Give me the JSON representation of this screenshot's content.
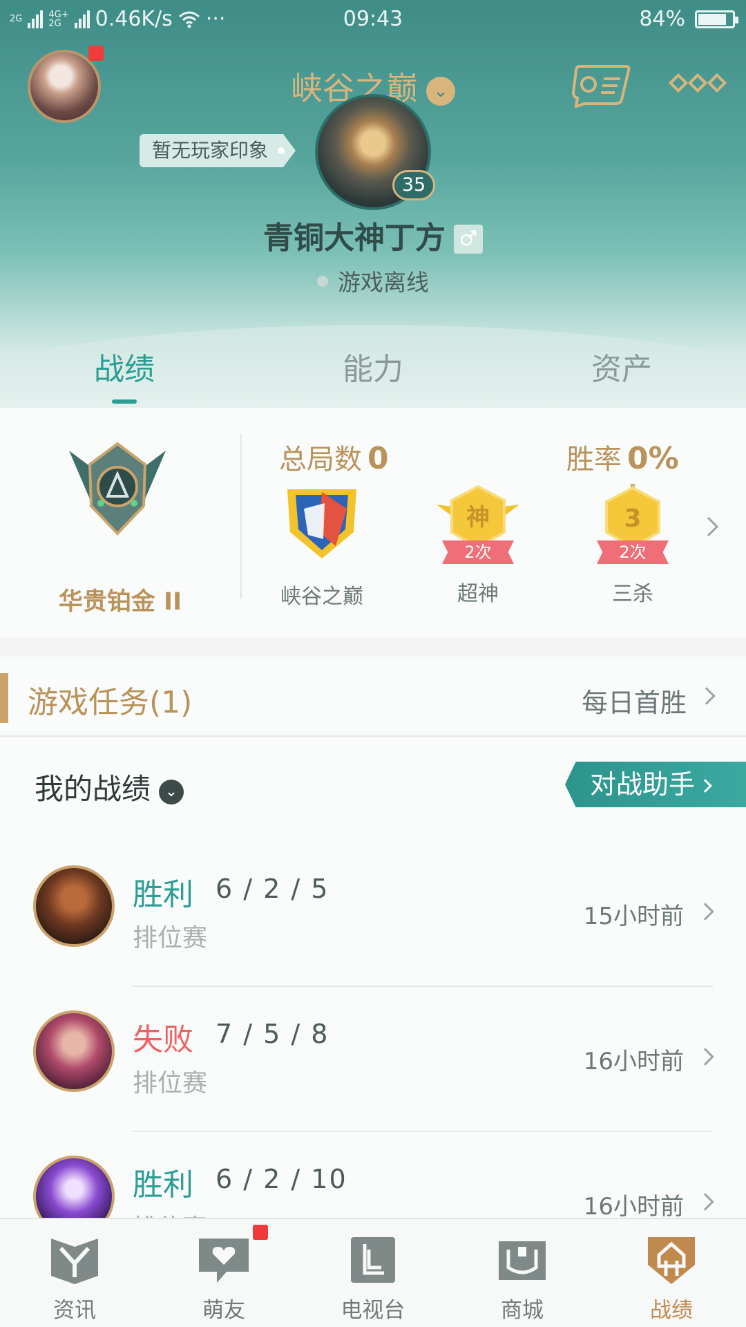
{
  "status_bar": {
    "network_label_1": "2G",
    "network_label_2": "4G+\n2G",
    "speed": "0.46K/s",
    "more": "···",
    "time": "09:43",
    "battery_percent": "84%",
    "battery_level": 0.84
  },
  "header": {
    "server_title": "峡谷之巅",
    "impression_tag": "暂无玩家印象",
    "level": "35",
    "player_name": "青铜大神丁方",
    "gender_symbol": "♂",
    "online_status": "游戏离线"
  },
  "tabs": [
    {
      "label": "战绩",
      "active": true
    },
    {
      "label": "能力",
      "active": false
    },
    {
      "label": "资产",
      "active": false
    }
  ],
  "stats": {
    "rank_name": "华贵铂金 II",
    "total_games_label": "总局数",
    "total_games_value": "0",
    "win_rate_label": "胜率",
    "win_rate_value": "0%",
    "badges": [
      {
        "label": "峡谷之巅",
        "count": ""
      },
      {
        "label": "超神",
        "count": "2次",
        "glyph": "神"
      },
      {
        "label": "三杀",
        "count": "2次",
        "glyph": "3"
      }
    ]
  },
  "task": {
    "title": "游戏任务(1)",
    "right_text": "每日首胜"
  },
  "records": {
    "title": "我的战绩",
    "assist_button": "对战助手",
    "matches": [
      {
        "result": "胜利",
        "outcome": "win",
        "kda": "6 / 2 / 5",
        "mode": "排位赛",
        "time": "15小时前"
      },
      {
        "result": "失败",
        "outcome": "lose",
        "kda": "7 / 5 / 8",
        "mode": "排位赛",
        "time": "16小时前"
      },
      {
        "result": "胜利",
        "outcome": "win",
        "kda": "6 / 2 / 10",
        "mode": "排位赛",
        "time": "16小时前"
      }
    ]
  },
  "bottom_nav": [
    {
      "label": "资讯",
      "icon": "news-icon",
      "active": false
    },
    {
      "label": "萌友",
      "icon": "friends-icon",
      "active": false,
      "has_dot": true
    },
    {
      "label": "电视台",
      "icon": "tv-icon",
      "active": false
    },
    {
      "label": "商城",
      "icon": "shop-icon",
      "active": false
    },
    {
      "label": "战绩",
      "icon": "records-icon",
      "active": true
    }
  ],
  "colors": {
    "header_teal": "#3f8c86",
    "accent_teal": "#2a9d95",
    "gold": "#b8935a",
    "lose_red": "#ef6262",
    "notification_red": "#ee3b3b"
  }
}
